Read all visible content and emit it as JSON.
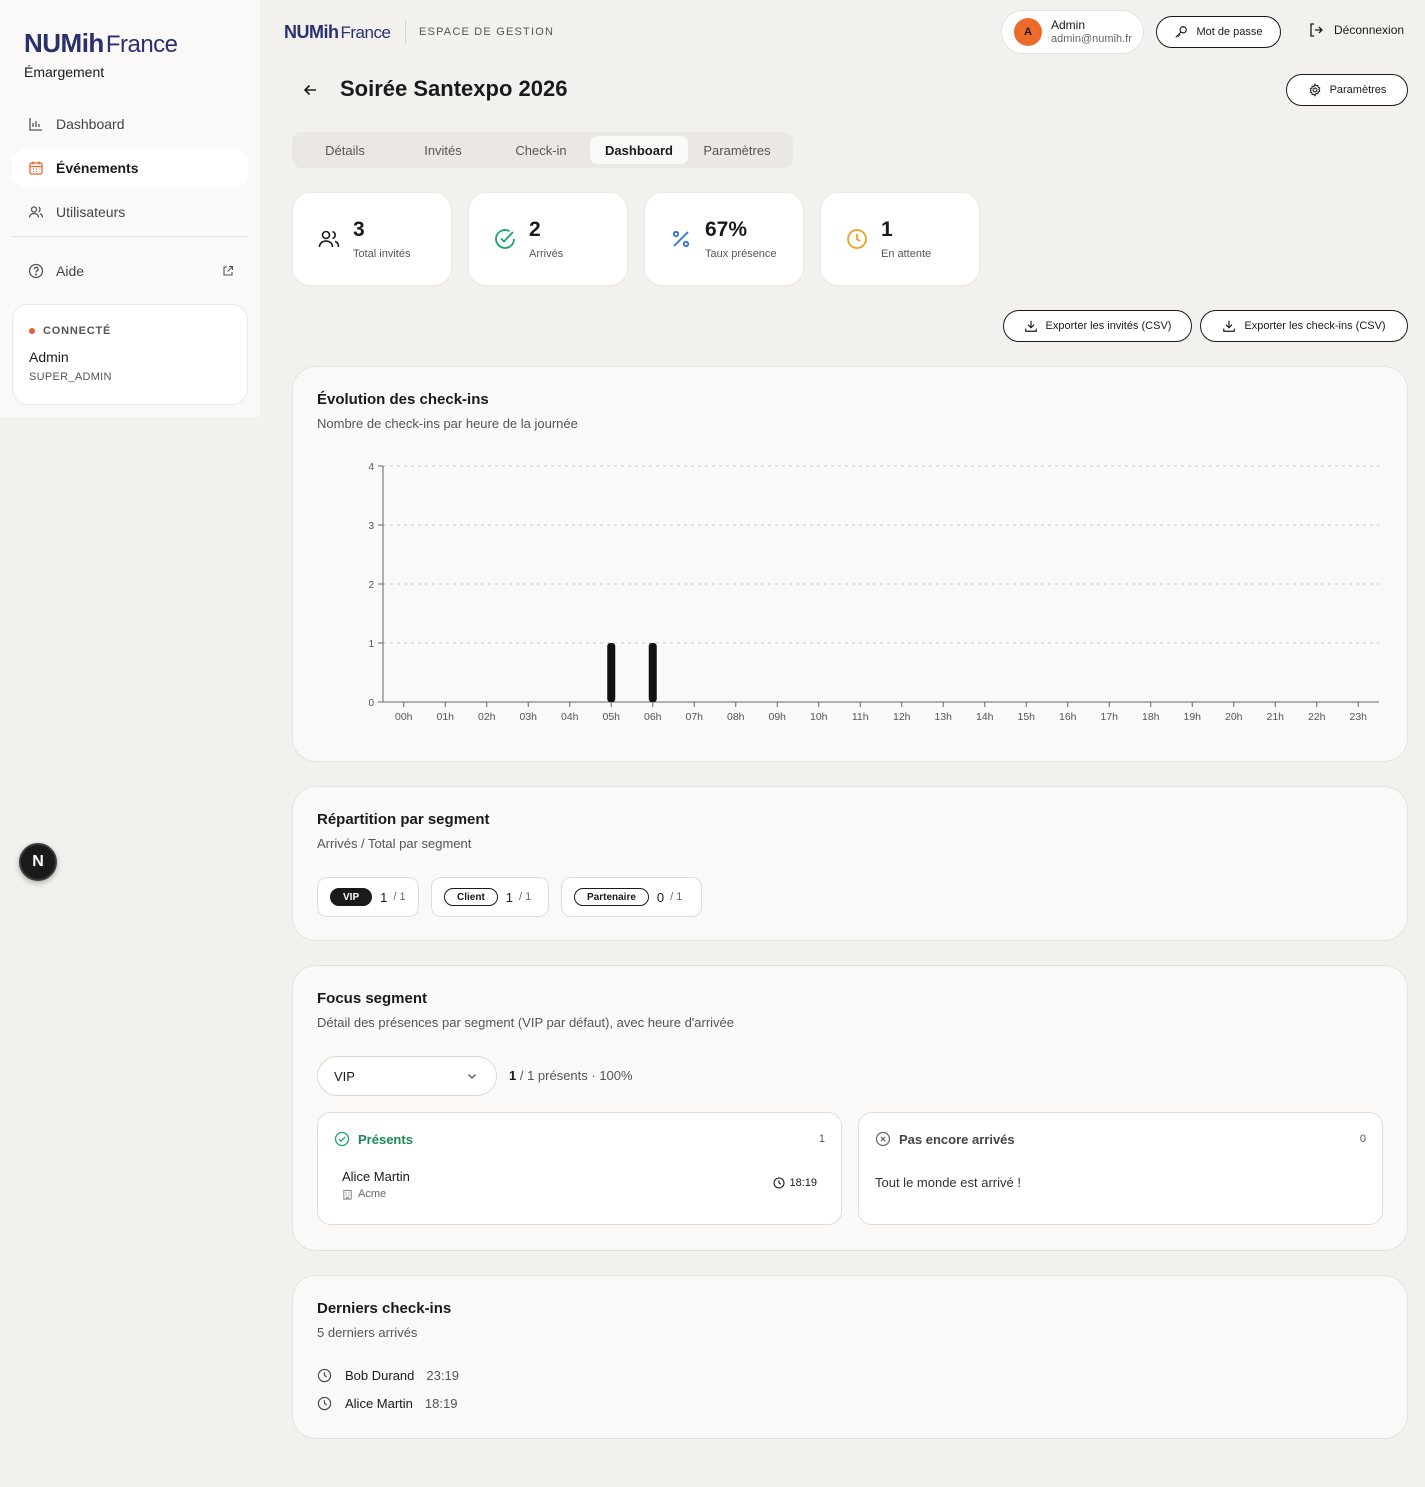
{
  "sidebar": {
    "logo_main": "NUMih",
    "logo_sub": "France",
    "subtitle": "Émargement",
    "items": [
      {
        "label": "Dashboard"
      },
      {
        "label": "Événements"
      },
      {
        "label": "Utilisateurs"
      }
    ],
    "help_label": "Aide",
    "connected": {
      "label": "CONNECTÉ",
      "name": "Admin",
      "role": "SUPER_ADMIN"
    }
  },
  "badge": "N",
  "topbar": {
    "logo_main": "NUMih",
    "logo_sub": "France",
    "space_label": "ESPACE DE GESTION",
    "user": {
      "initial": "A",
      "name": "Admin",
      "email": "admin@numih.fr"
    },
    "password_label": "Mot de passe",
    "logout_label": "Déconnexion"
  },
  "page": {
    "title": "Soirée Santexpo 2026",
    "settings_label": "Paramètres"
  },
  "tabs": [
    {
      "label": "Détails"
    },
    {
      "label": "Invités"
    },
    {
      "label": "Check-in"
    },
    {
      "label": "Dashboard",
      "active": true
    },
    {
      "label": "Paramètres"
    }
  ],
  "stats": [
    {
      "value": "3",
      "label": "Total invités",
      "icon": "users-icon",
      "color": "#1a1a1a"
    },
    {
      "value": "2",
      "label": "Arrivés",
      "icon": "check-circle-icon",
      "color": "#1aa56b"
    },
    {
      "value": "67%",
      "label": "Taux présence",
      "icon": "percent-icon",
      "color": "#2f6fe0"
    },
    {
      "value": "1",
      "label": "En attente",
      "icon": "clock-icon",
      "color": "#f0a020"
    }
  ],
  "exports": {
    "guests_label": "Exporter les invités (CSV)",
    "checkins_label": "Exporter les check-ins (CSV)"
  },
  "evolution": {
    "title": "Évolution des check-ins",
    "subtitle": "Nombre de check-ins par heure de la journée"
  },
  "chart_data": {
    "type": "bar",
    "categories": [
      "00h",
      "01h",
      "02h",
      "03h",
      "04h",
      "05h",
      "06h",
      "07h",
      "08h",
      "09h",
      "10h",
      "11h",
      "12h",
      "13h",
      "14h",
      "15h",
      "16h",
      "17h",
      "18h",
      "19h",
      "20h",
      "21h",
      "22h",
      "23h"
    ],
    "values": [
      0,
      0,
      0,
      0,
      0,
      1,
      1,
      0,
      0,
      0,
      0,
      0,
      0,
      0,
      0,
      0,
      0,
      0,
      0,
      0,
      0,
      0,
      0,
      0
    ],
    "yticks": [
      "0",
      "1",
      "2",
      "3",
      "4"
    ],
    "ylim": [
      0,
      4
    ],
    "grid": true,
    "color": "#111111"
  },
  "segments": {
    "title": "Répartition par segment",
    "subtitle": "Arrivés / Total par segment",
    "items": [
      {
        "name": "VIP",
        "count": "1",
        "total": "/ 1"
      },
      {
        "name": "Client",
        "count": "1",
        "total": "/ 1"
      },
      {
        "name": "Partenaire",
        "count": "0",
        "total": "/ 1"
      }
    ]
  },
  "focus": {
    "title": "Focus segment",
    "subtitle": "Détail des présences par segment (VIP par défaut), avec heure d'arrivée",
    "selected": "VIP",
    "summary_bold": "1",
    "summary_rest": " / 1 présents · 100%",
    "present": {
      "label": "Présents",
      "count": "1",
      "people": [
        {
          "name": "Alice Martin",
          "org": "Acme",
          "time": "18:19"
        }
      ]
    },
    "absent": {
      "label": "Pas encore arrivés",
      "count": "0",
      "empty": "Tout le monde est arrivé !"
    }
  },
  "last": {
    "title": "Derniers check-ins",
    "subtitle": "5 derniers arrivés",
    "rows": [
      {
        "name": "Bob Durand",
        "time": "23:19"
      },
      {
        "name": "Alice Martin",
        "time": "18:19"
      }
    ]
  }
}
